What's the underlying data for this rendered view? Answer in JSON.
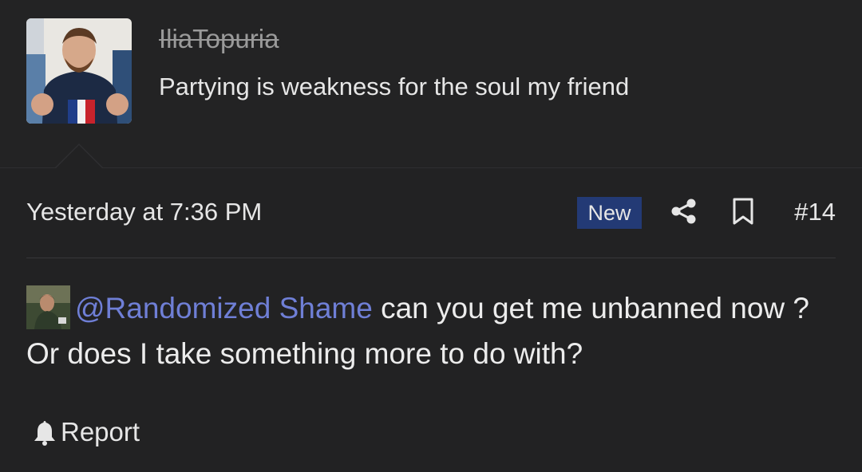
{
  "poster": {
    "username": "IliaTopuria",
    "title": "Partying is weakness for the soul my friend"
  },
  "post": {
    "date": "Yesterday at 7:36 PM",
    "badge": "New",
    "number": "#14",
    "mention": "@Randomized Shame",
    "message": "can you get me unbanned now ? Or does I take something more to do with?",
    "report_label": "Report"
  },
  "colors": {
    "background": "#222223",
    "badge": "#233a75",
    "mention": "#6f7fd6"
  }
}
